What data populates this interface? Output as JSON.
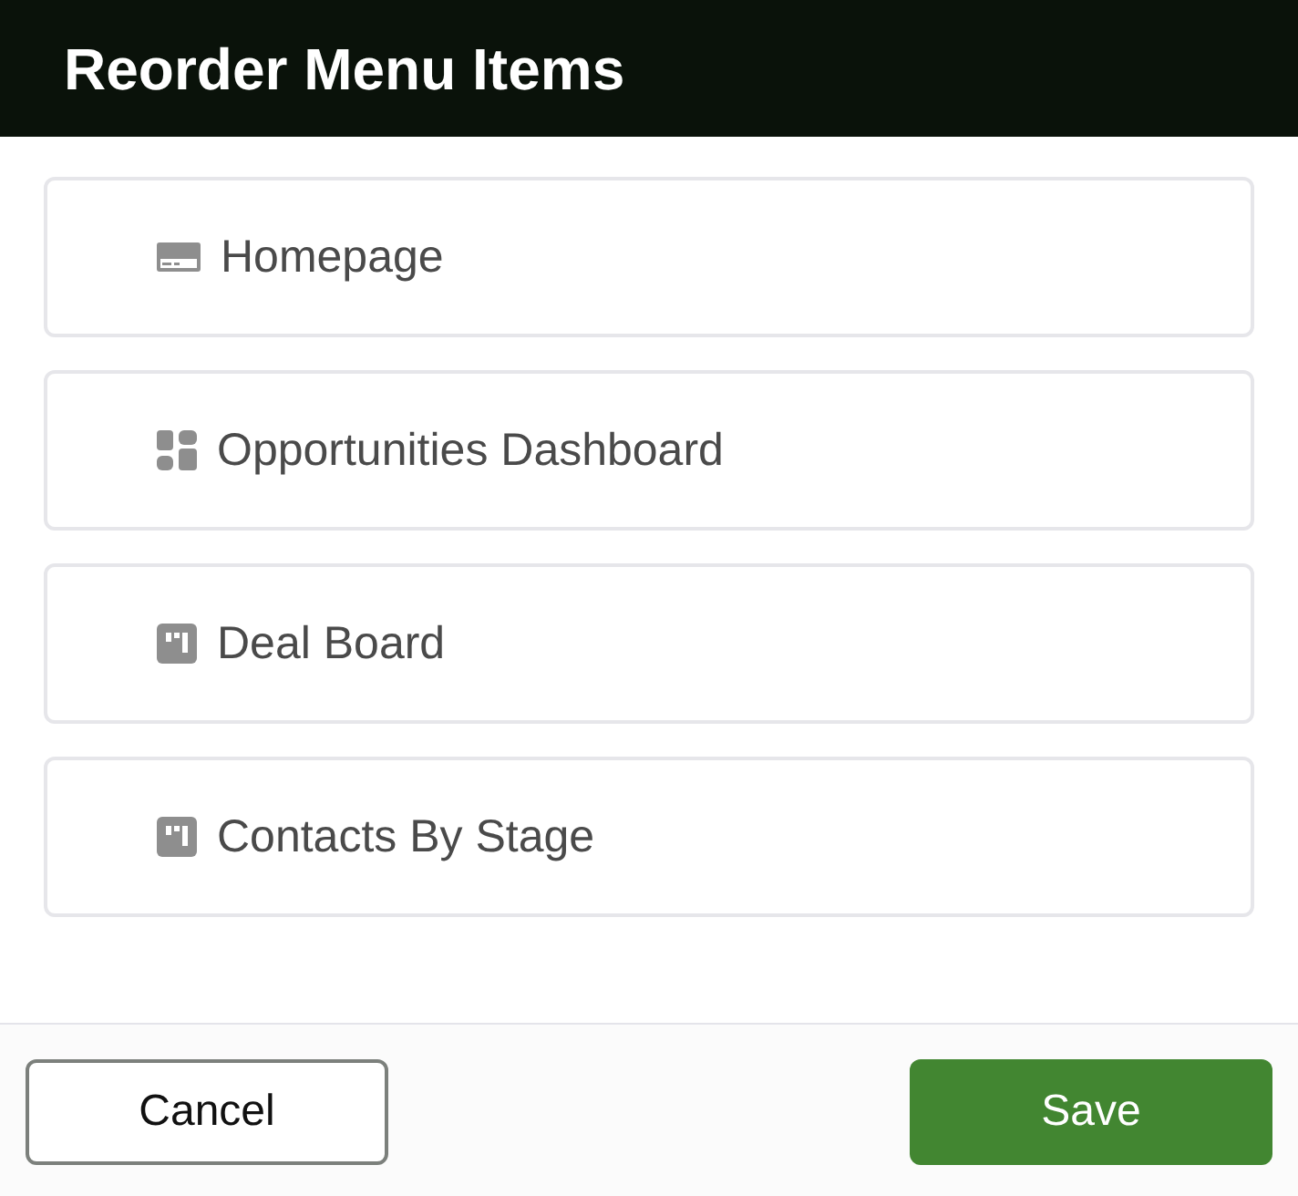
{
  "dialog": {
    "title": "Reorder Menu Items"
  },
  "items": [
    {
      "label": "Homepage",
      "kind": "page"
    },
    {
      "label": "Opportunities Dashboard",
      "kind": "dashboard"
    },
    {
      "label": "Deal Board",
      "kind": "board"
    },
    {
      "label": "Contacts By Stage",
      "kind": "board"
    }
  ],
  "buttons": [
    {
      "label": "Cancel",
      "kind": "secondary"
    },
    {
      "label": "Save",
      "kind": "primary"
    }
  ]
}
